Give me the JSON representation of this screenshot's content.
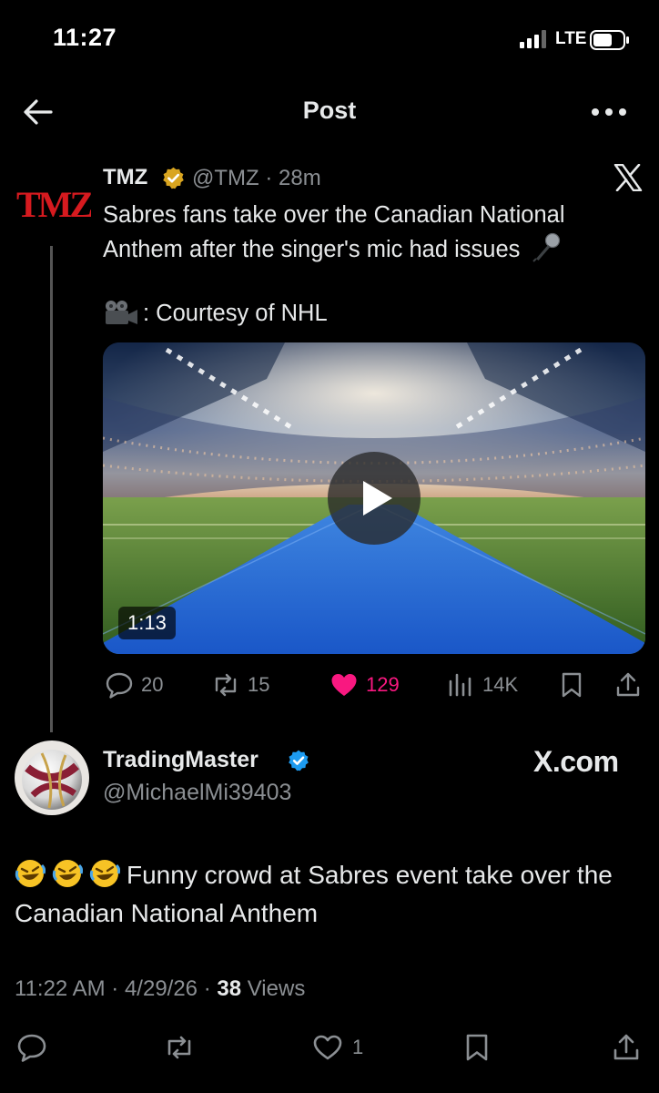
{
  "status_bar": {
    "time": "11:27",
    "network": "LTE"
  },
  "header": {
    "title": "Post",
    "back_icon": "arrow-left-icon",
    "more_icon": "more-horizontal-icon"
  },
  "quoted_post": {
    "logo_text": "TMZ",
    "author_name": "TMZ",
    "handle_time": "@TMZ · 28m",
    "text": "Sabres fans take over the Canadian National Anthem after the singer's mic had issues",
    "courtesy": ": Courtesy of NHL",
    "video_duration": "1:13",
    "stats": {
      "replies": "20",
      "reposts": "15",
      "likes": "129",
      "views": "14K"
    },
    "like_color": "#f91880",
    "verified_color": "#d9a520"
  },
  "reply_post": {
    "author_name": "TradingMaster",
    "handle": "@MichaelMi39403",
    "watermark": "X.com",
    "text": "Funny crowd at Sabres event take over the Canadian National Anthem",
    "timestamp": "11:22 AM · 4/29/26 · ",
    "views_count": "38",
    "views_label": " Views",
    "likes": "1",
    "verified_color": "#1d9bf0"
  }
}
